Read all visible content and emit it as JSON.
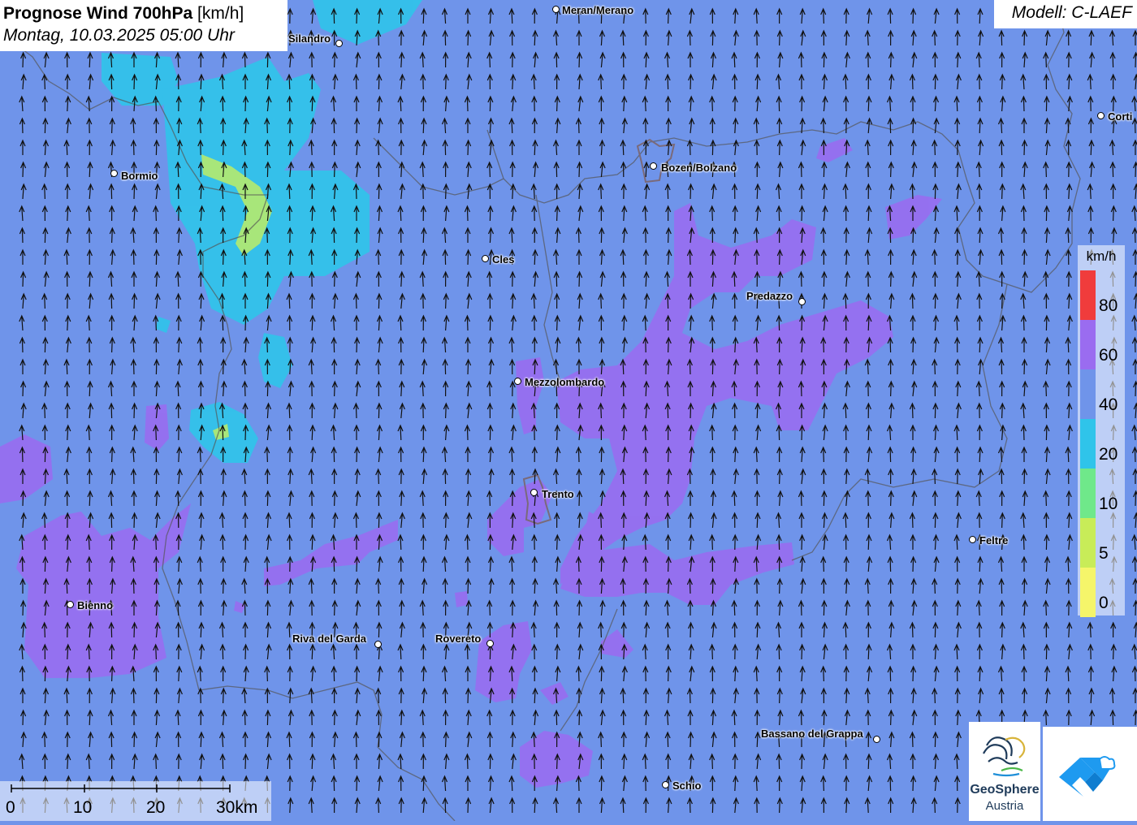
{
  "title": {
    "main": "Prognose Wind 700hPa",
    "unit": "[km/h]",
    "datetime": "Montag, 10.03.2025 05:00 Uhr"
  },
  "model_label": "Modell: C-LAEF",
  "legend": {
    "unit": "km/h",
    "labels": [
      "80",
      "60",
      "40",
      "20",
      "10",
      "5",
      "0"
    ],
    "colors": [
      "#f03c3c",
      "#9a6cf0",
      "#6f94ea",
      "#2fc4ea",
      "#6fe88a",
      "#c8ec58",
      "#f5f56a"
    ]
  },
  "cities": [
    {
      "name": "Meran/Merano"
    },
    {
      "name": "Silandro"
    },
    {
      "name": "Bormio"
    },
    {
      "name": "Bozen/Bolzano"
    },
    {
      "name": "Corti"
    },
    {
      "name": "Cles"
    },
    {
      "name": "Predazzo"
    },
    {
      "name": "Mezzolombardo"
    },
    {
      "name": "Trento"
    },
    {
      "name": "Feltre"
    },
    {
      "name": "Bienno"
    },
    {
      "name": "Riva del Garda"
    },
    {
      "name": "Rovereto"
    },
    {
      "name": "Bassano del Grappa"
    },
    {
      "name": "Schio"
    }
  ],
  "scalebar": {
    "labels": [
      "0",
      "10",
      "20",
      "30km"
    ]
  },
  "logos": {
    "geosphere_line1": "GeoSphere",
    "geosphere_line2": "Austria"
  },
  "icons": {
    "wind_arrow": "arrow-up-icon",
    "geosphere": "geosphere-logo",
    "app": "weather-app-logo"
  }
}
